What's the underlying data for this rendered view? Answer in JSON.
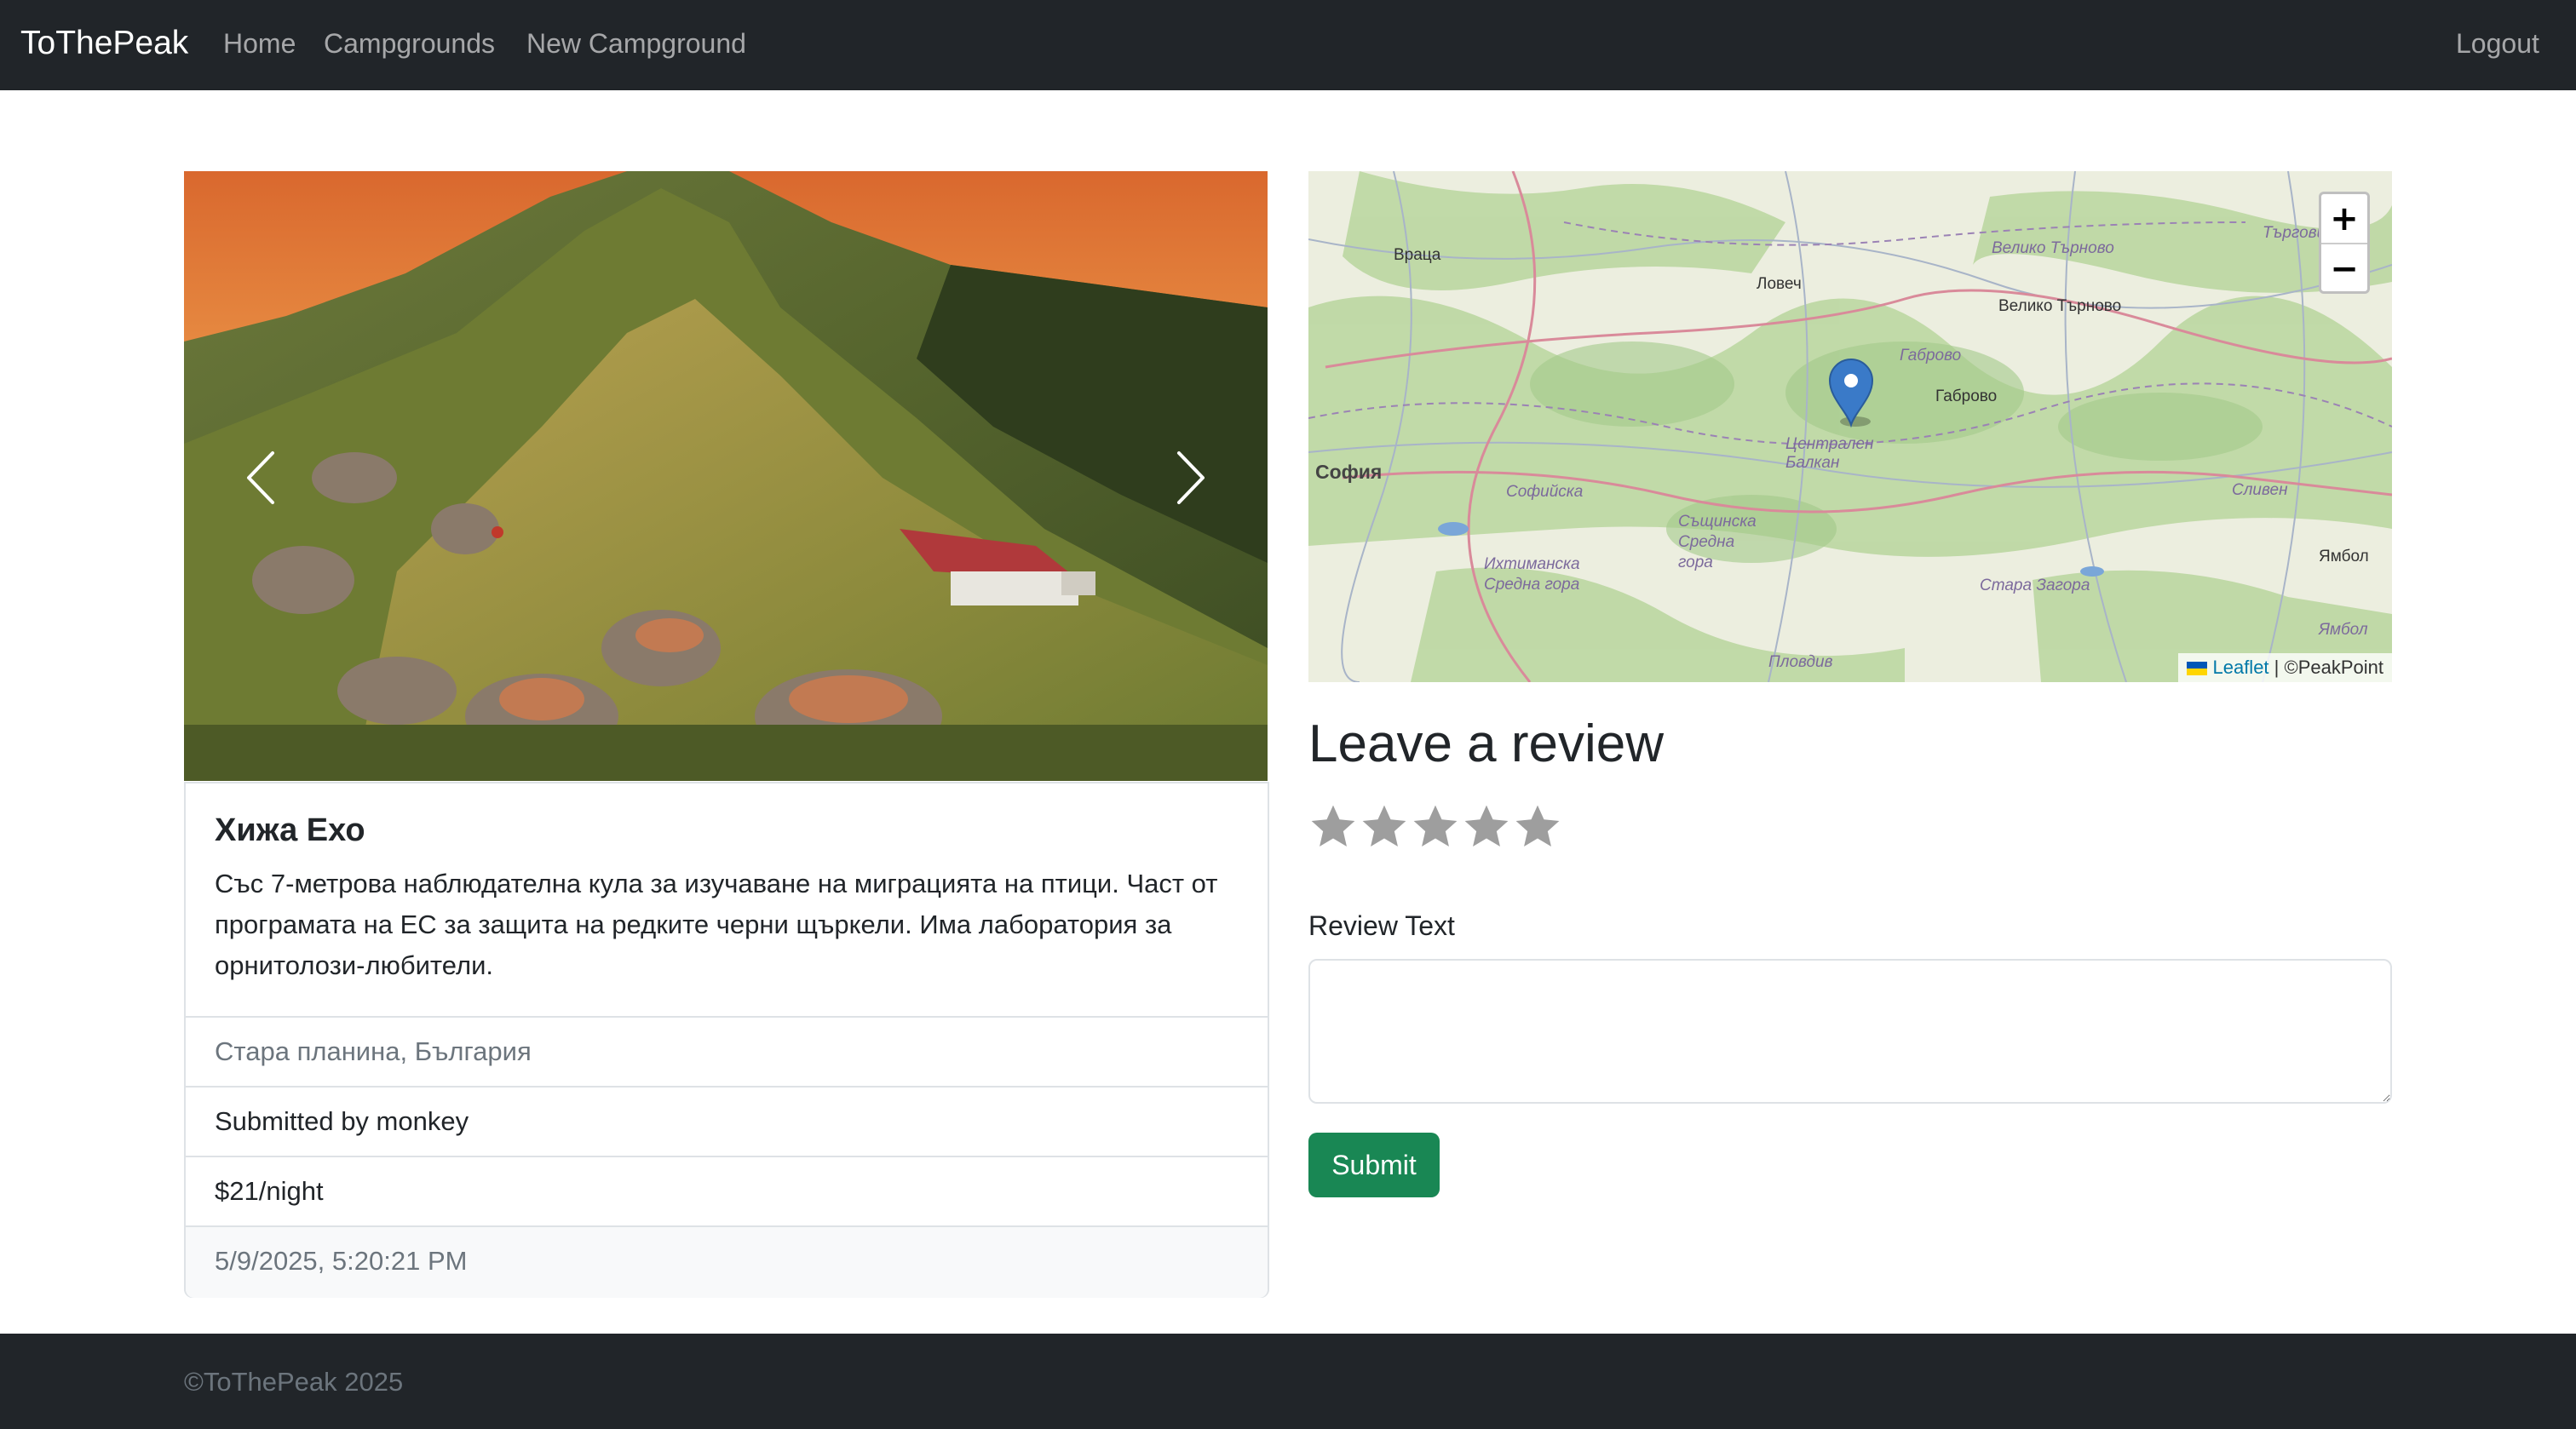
{
  "navbar": {
    "brand": "ToThePeak",
    "links": [
      "Home",
      "Campgrounds",
      "New Campground"
    ],
    "logout": "Logout"
  },
  "campground": {
    "title": "Хижа Ехо",
    "description": "Със 7-метрова наблюдателна кула за изучаване на миграцията на птици. Част от програмата на ЕС за защита на редките черни щъркели. Има лаборатория за орнитолози-любители.",
    "location": "Стара планина, България",
    "submitted_by": "Submitted by monkey",
    "price": "$21/night",
    "timestamp": "5/9/2025, 5:20:21 PM"
  },
  "carousel": {
    "prev_icon": "chevron-left-icon",
    "next_icon": "chevron-right-icon"
  },
  "map": {
    "zoom_in": "+",
    "zoom_out": "−",
    "attribution_link": "Leaflet",
    "attribution_text": "| ©PeakPoint",
    "labels": [
      "Враца",
      "Ловеч",
      "Велико Търново",
      "Велико Търново",
      "Търговище",
      "Габрово",
      "Габрово",
      "Централен Балкан",
      "София",
      "Софийска",
      "Същинска Средна гора",
      "Ихтиманска Средна гора",
      "Стара Загора",
      "Сливен",
      "Ямбол",
      "Ямбол",
      "Пловдив"
    ]
  },
  "review": {
    "title": "Leave a review",
    "rating": 0,
    "rating_max": 5,
    "label": "Review Text",
    "textarea_value": "",
    "submit_label": "Submit"
  },
  "footer": {
    "copyright": "©ToThePeak 2025"
  },
  "colors": {
    "navbar_bg": "#212529",
    "submit_bg": "#198754",
    "star_color": "#9e9e9e",
    "marker": "#3a7ac8"
  }
}
